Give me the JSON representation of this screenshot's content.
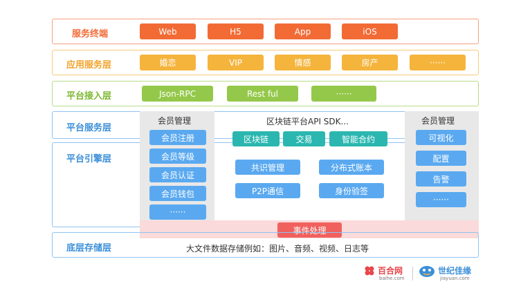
{
  "layers": {
    "terminal": {
      "label": "服务终端",
      "items": [
        "Web",
        "H5",
        "App",
        "iOS"
      ]
    },
    "app_service": {
      "label": "应用服务层",
      "items": [
        "婚恋",
        "VIP",
        "情感",
        "房产",
        "······"
      ]
    },
    "access": {
      "label": "平台接入层",
      "items": [
        "Json-RPC",
        "Rest ful",
        "······"
      ]
    },
    "platform_service": {
      "label": "平台服务层"
    },
    "engine": {
      "label": "平台引擎层"
    },
    "storage": {
      "label": "底层存储层",
      "text": "大文件数据存储例如：图片、音频、视频、日志等"
    }
  },
  "left_panel": {
    "title": "会员管理",
    "items": [
      "会员注册",
      "会员等级",
      "会员认证",
      "会员钱包",
      "······"
    ]
  },
  "center_panel": {
    "title": "区块链平台API SDK...",
    "top_items": [
      "区块链",
      "交易",
      "智能合约"
    ],
    "grid_items": [
      "共识管理",
      "分布式账本",
      "P2P通信",
      "身份验签"
    ]
  },
  "right_panel": {
    "title": "会员管理",
    "items": [
      "可视化",
      "配置",
      "告警",
      "······"
    ]
  },
  "event": {
    "label": "事件处理"
  },
  "logos": {
    "baihe": {
      "name": "百合网",
      "sub": "baihe.com"
    },
    "jiayuan": {
      "name": "世纪佳缘",
      "sub": "jiayuan.com"
    }
  },
  "colors": {
    "terminal": "#f26b35",
    "app_service": "#f5b43c",
    "access": "#94c84a",
    "service": "#5aa9f0",
    "blockchain": "#2bb7b0",
    "event": "#f0615e"
  }
}
